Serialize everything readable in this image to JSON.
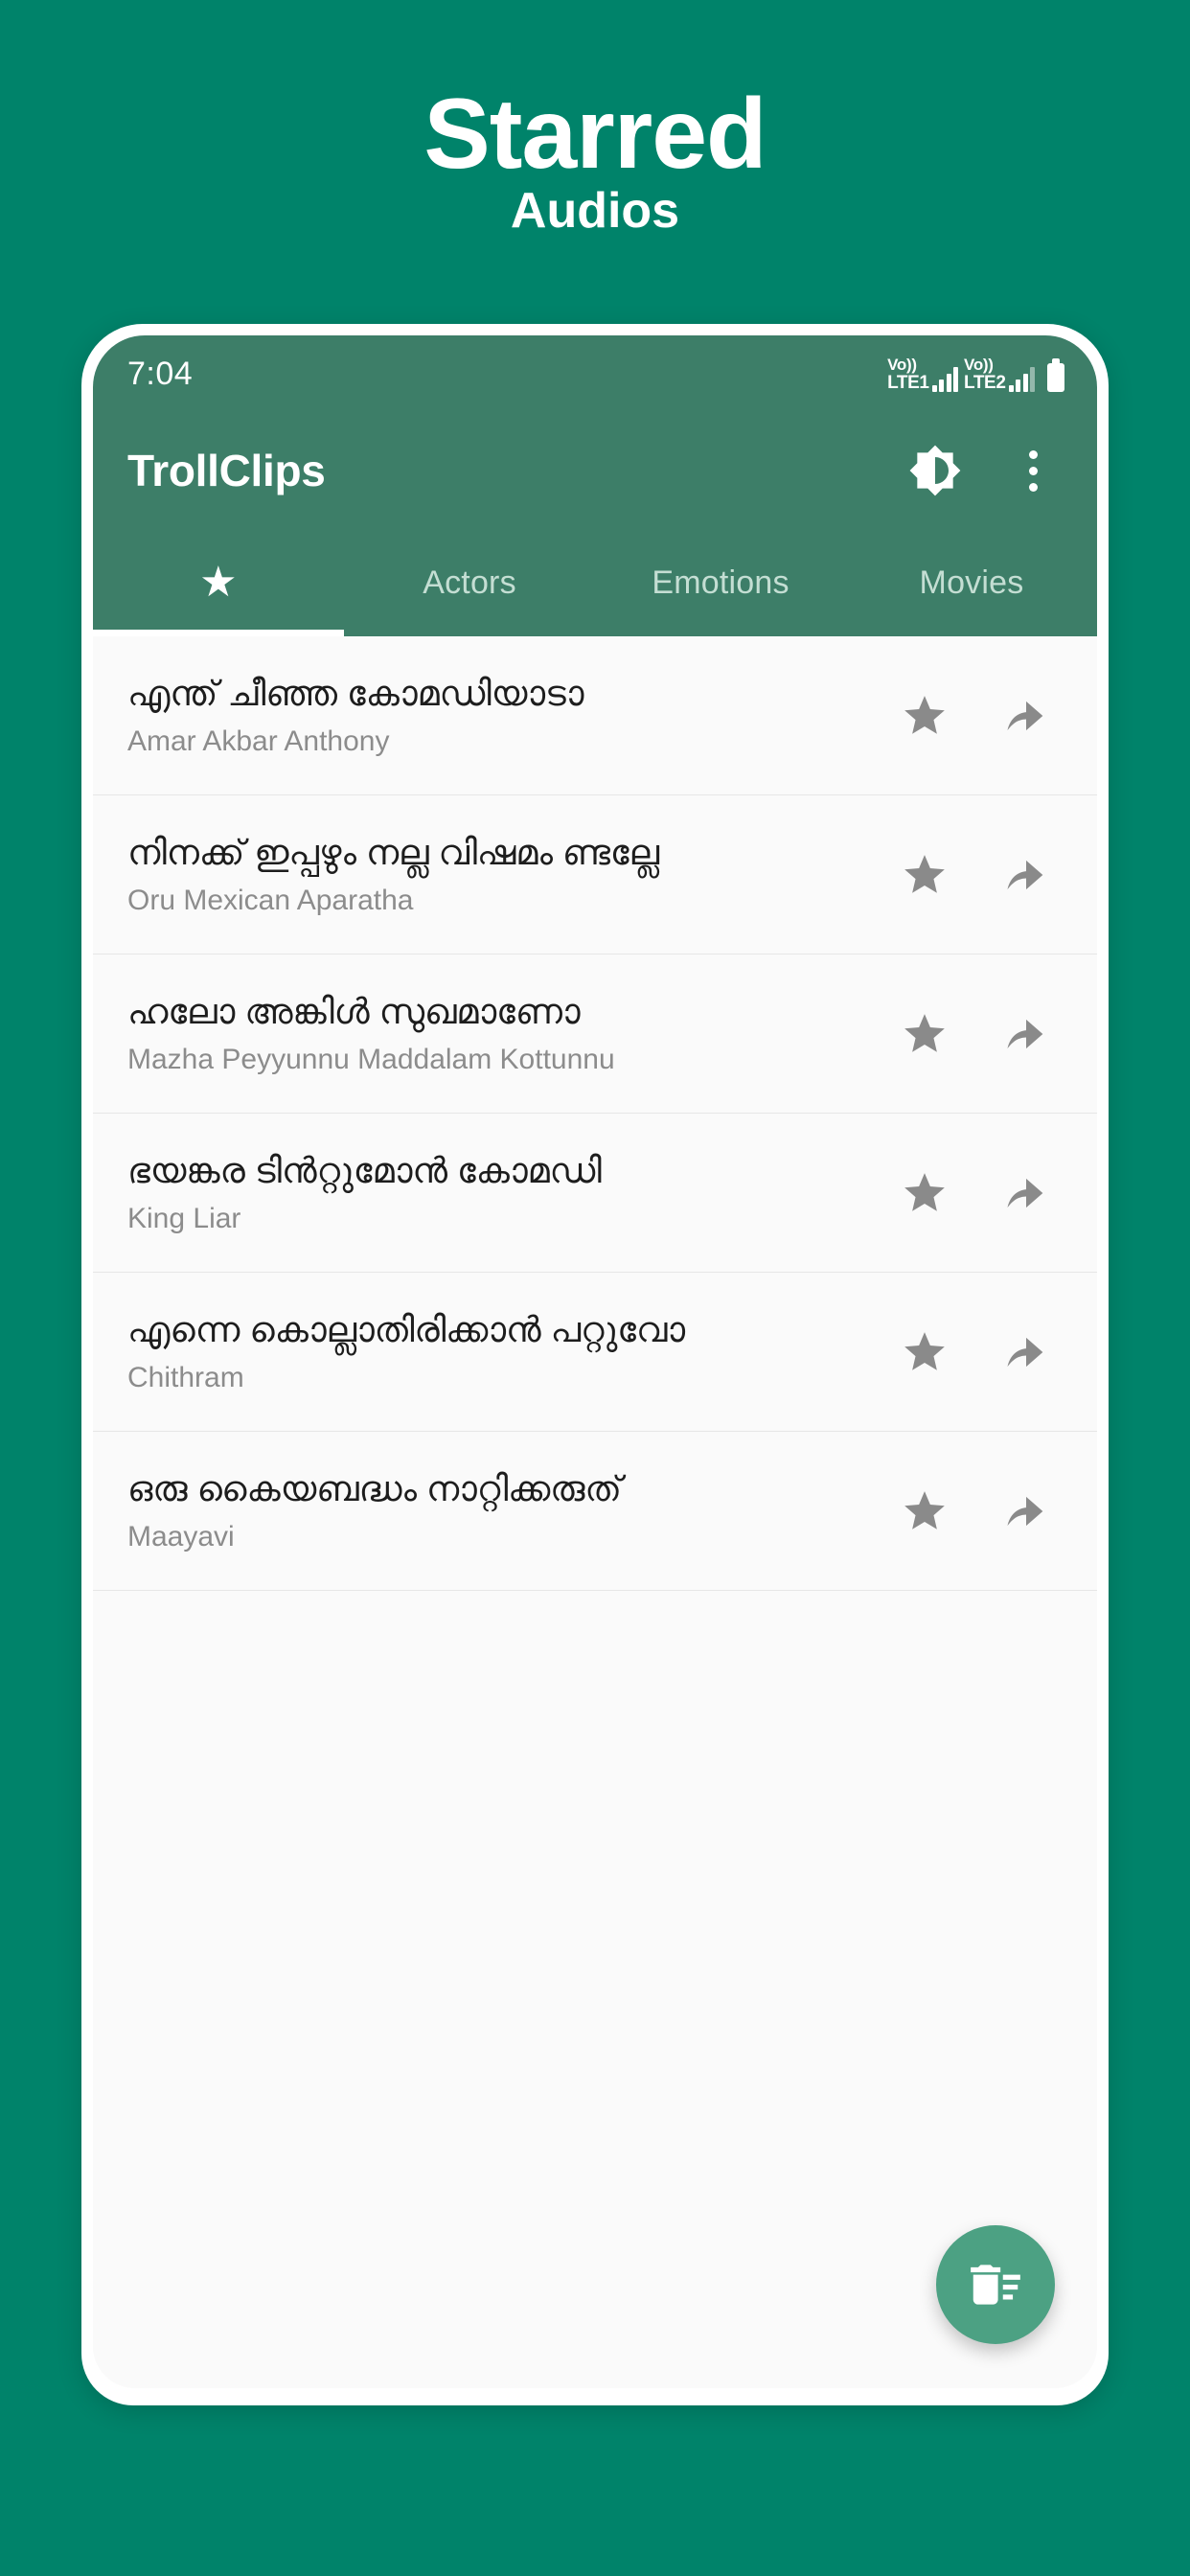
{
  "promo": {
    "title": "Starred",
    "subtitle": "Audios",
    "background_color": "#00836a"
  },
  "phone": {
    "statusbar": {
      "time": "7:04",
      "sim1_network_label": "LTE1",
      "sim1_volte_label": "Vo))",
      "sim2_network_label": "LTE2",
      "sim2_volte_label": "Vo))",
      "battery_icon": "battery-icon"
    },
    "appbar": {
      "title": "TrollClips",
      "theme_toggle_icon": "brightness-medium-icon",
      "overflow_icon": "more-vert-icon",
      "background_color": "#3d7e68"
    },
    "tabs": [
      {
        "label": "★",
        "name": "starred",
        "icon": "star-icon",
        "active": true
      },
      {
        "label": "Actors",
        "name": "actors",
        "icon": "",
        "active": false
      },
      {
        "label": "Emotions",
        "name": "emotions",
        "icon": "",
        "active": false
      },
      {
        "label": "Movies",
        "name": "movies",
        "icon": "",
        "active": false
      }
    ],
    "list": {
      "items": [
        {
          "title": "എന്ത് ചീഞ്ഞ കോമഡിയാടാ",
          "subtitle": "Amar Akbar Anthony",
          "star_icon": "star-filled-icon",
          "share_icon": "share-arrow-icon"
        },
        {
          "title": "നിനക്ക് ഇപ്പഴും നല്ല വിഷമം ണ്ടല്ലേ",
          "subtitle": "Oru Mexican Aparatha",
          "star_icon": "star-filled-icon",
          "share_icon": "share-arrow-icon"
        },
        {
          "title": "ഹലോ അങ്കിൾ സുഖമാണോ",
          "subtitle": "Mazha Peyyunnu Maddalam Kottunnu",
          "star_icon": "star-filled-icon",
          "share_icon": "share-arrow-icon"
        },
        {
          "title": "ഭയങ്കര ടിൻറ്റുമോൻ കോമഡി",
          "subtitle": "King Liar",
          "star_icon": "star-filled-icon",
          "share_icon": "share-arrow-icon"
        },
        {
          "title": "എന്നെ കൊല്ലാതിരിക്കാൻ പറ്റുവോ",
          "subtitle": "Chithram",
          "star_icon": "star-filled-icon",
          "share_icon": "share-arrow-icon"
        },
        {
          "title": "ഒരു കൈയബദ്ധം നാറ്റിക്കരുത്",
          "subtitle": "Maayavi",
          "star_icon": "star-filled-icon",
          "share_icon": "share-arrow-icon"
        }
      ]
    },
    "fab": {
      "icon": "delete-sweep-icon",
      "color": "#4ca183"
    }
  }
}
